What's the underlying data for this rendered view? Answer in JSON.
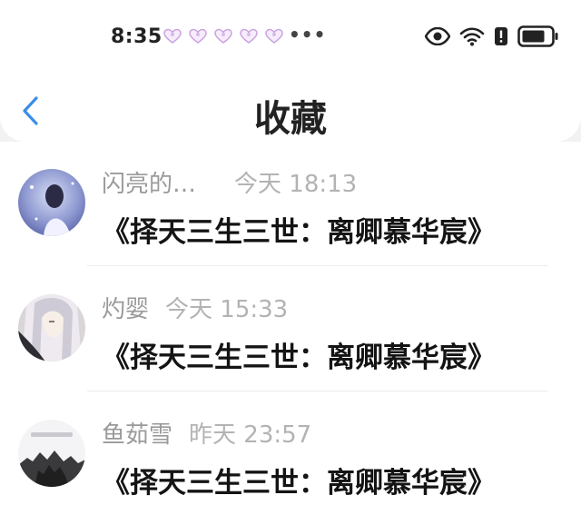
{
  "status_bar": {
    "time": "8:35",
    "more": "•••",
    "icons": [
      "heart-icon",
      "eye-icon",
      "wifi-icon",
      "alert-icon",
      "battery-icon"
    ]
  },
  "nav": {
    "title": "收藏",
    "back_icon": "chevron-left-icon"
  },
  "colors": {
    "accent": "#3a8ee6",
    "meta_text": "#a8a8a8",
    "heart": "#c9a3e0"
  },
  "items": [
    {
      "user": "闪亮的…",
      "date": "今天 18:13",
      "book": "《择天三生三世：离卿慕华宸》"
    },
    {
      "user": "灼婴",
      "date": "今天 15:33",
      "book": "《择天三生三世：离卿慕华宸》"
    },
    {
      "user": "鱼茹雪",
      "date": "昨天 23:57",
      "book": "《择天三生三世：离卿慕华宸》"
    }
  ]
}
